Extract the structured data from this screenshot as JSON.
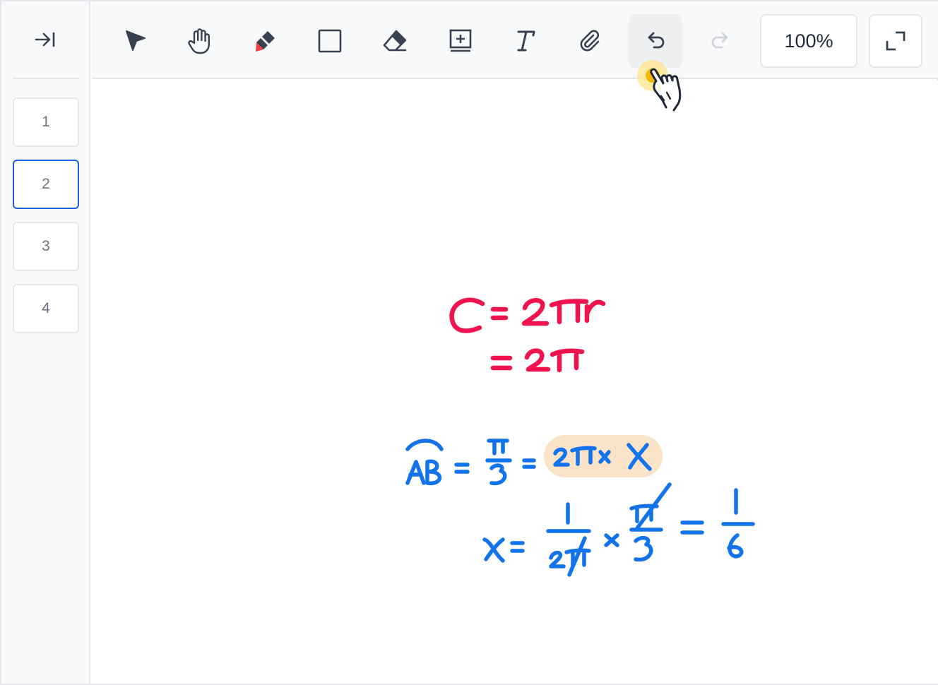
{
  "sidebar": {
    "collapse_icon": "collapse-right-bar-icon",
    "pages": [
      {
        "label": "1",
        "active": false
      },
      {
        "label": "2",
        "active": true
      },
      {
        "label": "3",
        "active": false
      },
      {
        "label": "4",
        "active": false
      }
    ]
  },
  "toolbar": {
    "tools": [
      {
        "name": "select-tool",
        "icon": "pointer-arrow-icon"
      },
      {
        "name": "pan-tool",
        "icon": "hand-icon"
      },
      {
        "name": "highlighter-tool",
        "icon": "marker-icon"
      },
      {
        "name": "rectangle-tool",
        "icon": "square-icon"
      },
      {
        "name": "eraser-tool",
        "icon": "eraser-icon"
      },
      {
        "name": "add-page-tool",
        "icon": "add-page-icon"
      },
      {
        "name": "text-tool",
        "icon": "text-t-icon"
      },
      {
        "name": "attach-tool",
        "icon": "paperclip-icon"
      },
      {
        "name": "undo-button",
        "icon": "undo-icon",
        "hovered": true
      },
      {
        "name": "redo-button",
        "icon": "redo-icon",
        "disabled": true
      }
    ],
    "zoom_label": "100%",
    "expand_icon": "expand-icon"
  },
  "colors": {
    "accent": "#1a5fe0",
    "ink_red": "#f0134d",
    "ink_blue": "#1273ea",
    "highlight": "#fbe3c8",
    "cursor_dot": "#f5c518"
  }
}
